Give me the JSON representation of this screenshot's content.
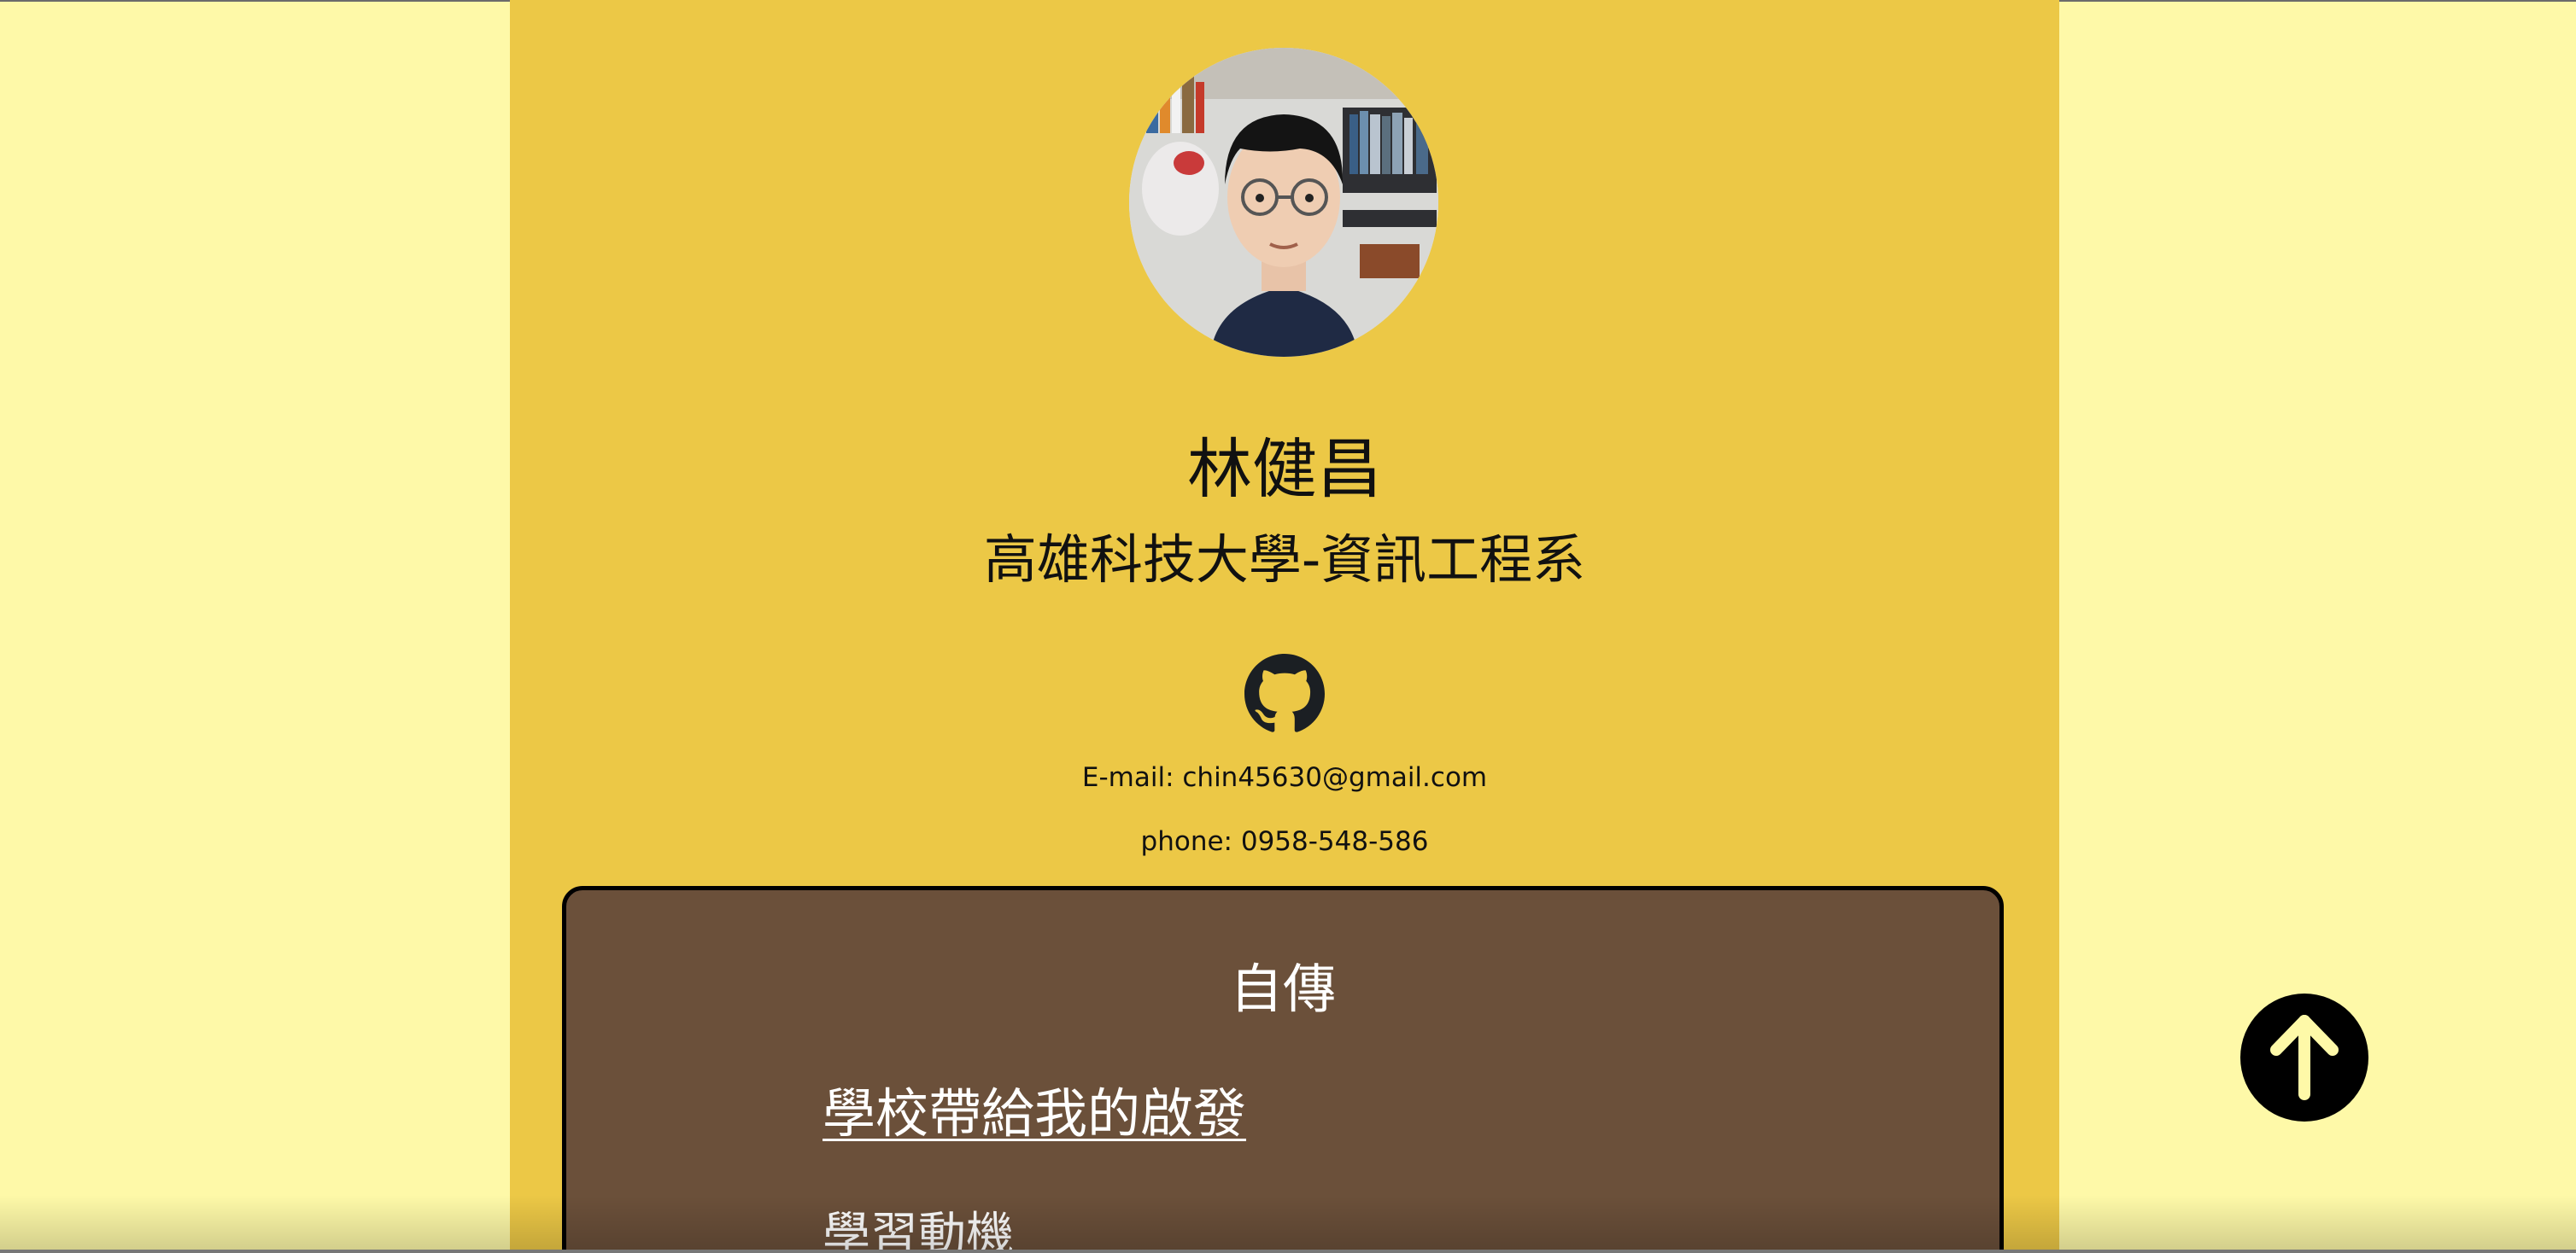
{
  "profile": {
    "name": "林健昌",
    "school": "高雄科技大學-資訊工程系",
    "email": "E-mail: chin45630@gmail.com",
    "phone": "phone: 0958-548-586"
  },
  "bio": {
    "title": "自傳",
    "link_label": "學校帶給我的啟發",
    "subheading": "學習動機"
  },
  "icons": {
    "github": "github-icon",
    "scroll_top": "arrow-up-icon"
  },
  "colors": {
    "page_background": "#fef9a8",
    "column_background": "#ecc846",
    "card_background": "#6b503a",
    "card_border": "#000000",
    "scroll_button": "#000000",
    "scroll_arrow": "#fef9a8"
  }
}
